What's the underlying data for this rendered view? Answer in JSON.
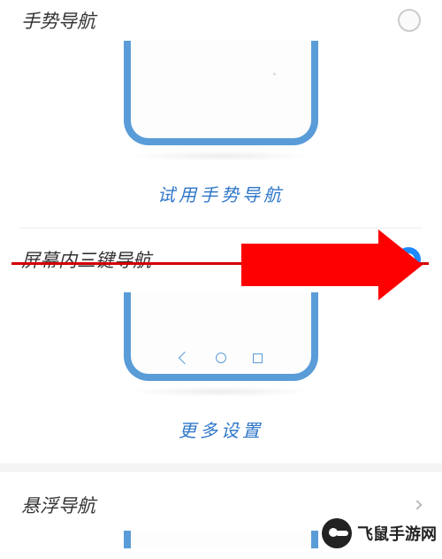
{
  "options": {
    "gesture": {
      "title": "手势导航",
      "try_link": "试用手势导航",
      "selected": false
    },
    "three_key": {
      "title": "屏幕内三键导航",
      "more_link": "更多设置",
      "selected": true
    },
    "dock": {
      "title": "悬浮导航"
    }
  },
  "watermark": "飞鼠手游网",
  "colors": {
    "link": "#2f77c9",
    "phone_frame": "#5a9cd8",
    "accent": "#1e88ff",
    "arrow": "#ff0000"
  }
}
